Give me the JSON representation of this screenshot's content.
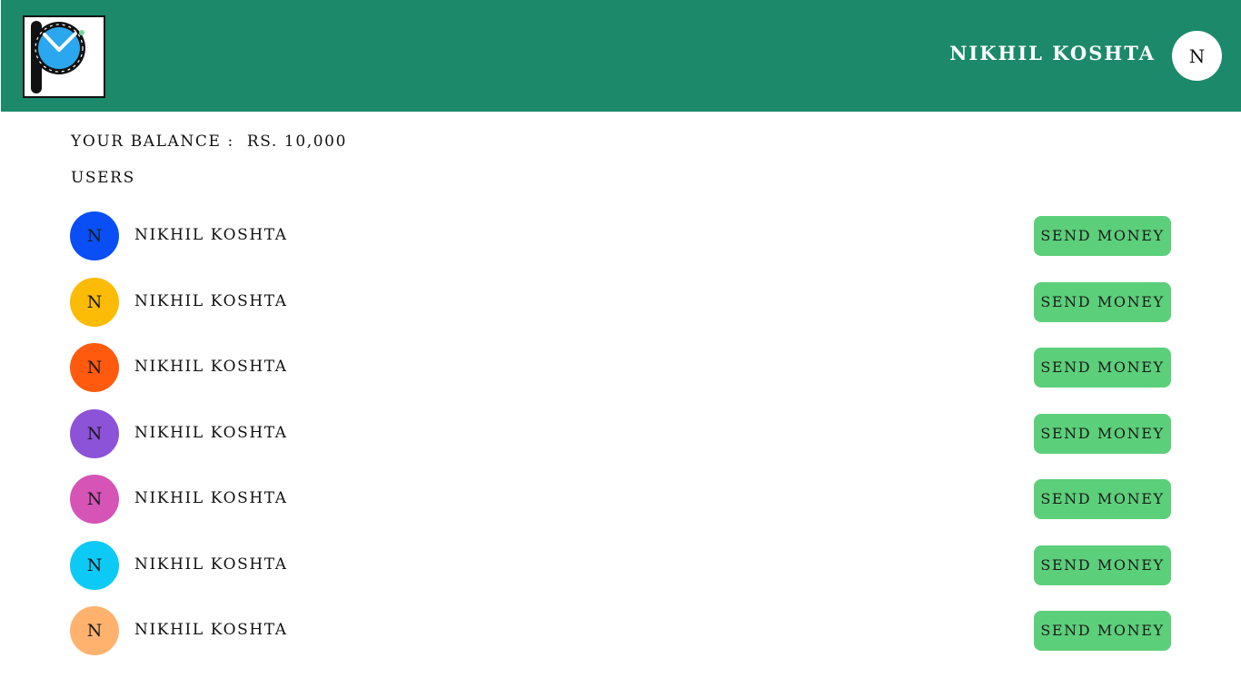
{
  "header": {
    "user_name": "NIKHIL KOSHTA",
    "avatar_initial": "N",
    "background": "#1b896a"
  },
  "balance": {
    "label": "YOUR BALANCE :",
    "amount": "RS. 10,000"
  },
  "users_heading": "USERS",
  "users": [
    {
      "initial": "N",
      "name": "NIKHIL KOSHTA",
      "color": "#0a4ff5",
      "action": "SEND MONEY"
    },
    {
      "initial": "N",
      "name": "NIKHIL KOSHTA",
      "color": "#fcbb04",
      "action": "SEND MONEY"
    },
    {
      "initial": "N",
      "name": "NIKHIL KOSHTA",
      "color": "#ff5a0e",
      "action": "SEND MONEY"
    },
    {
      "initial": "N",
      "name": "NIKHIL KOSHTA",
      "color": "#8c52d8",
      "action": "SEND MONEY"
    },
    {
      "initial": "N",
      "name": "NIKHIL KOSHTA",
      "color": "#d654b6",
      "action": "SEND MONEY"
    },
    {
      "initial": "N",
      "name": "NIKHIL KOSHTA",
      "color": "#0ccaf5",
      "action": "SEND MONEY"
    },
    {
      "initial": "N",
      "name": "NIKHIL KOSHTA",
      "color": "#ffb26e",
      "action": "SEND MONEY"
    }
  ],
  "colors": {
    "accent": "#1b896a",
    "button": "#5ccf7a"
  },
  "icons": {
    "logo": "p-clock-logo-icon"
  }
}
